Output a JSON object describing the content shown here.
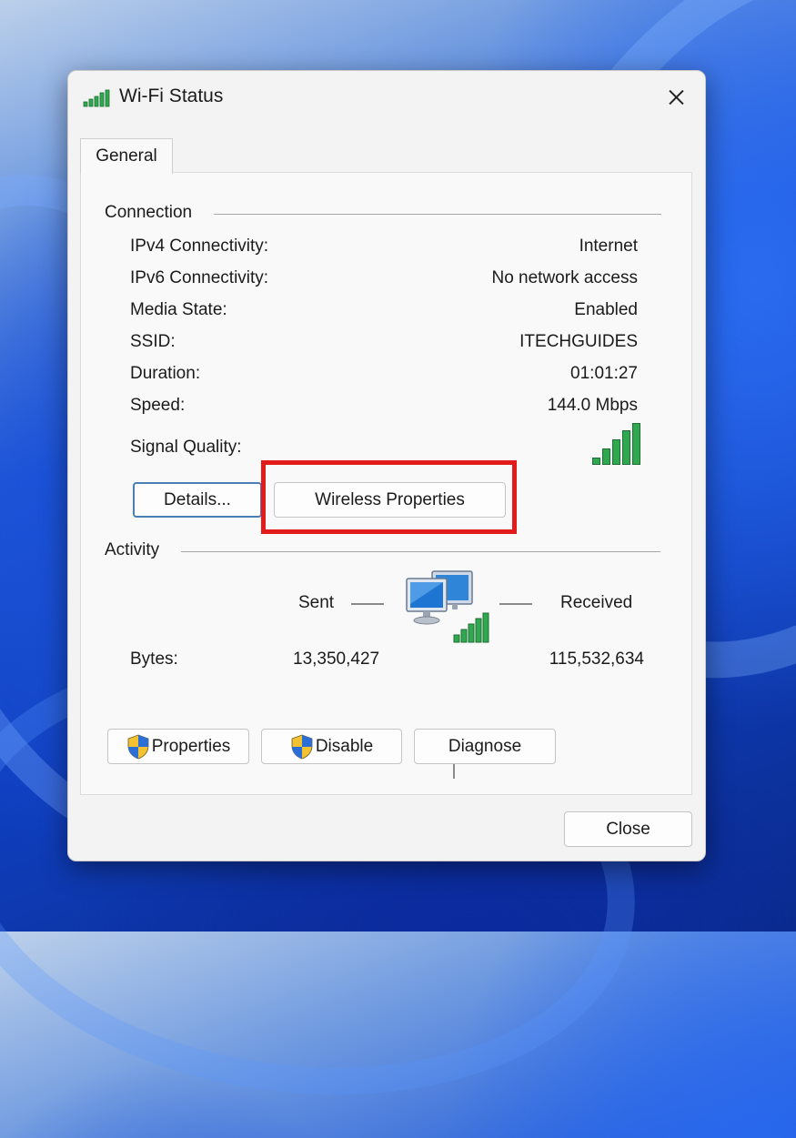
{
  "window": {
    "title": "Wi-Fi Status"
  },
  "tabs": [
    {
      "label": "General"
    }
  ],
  "connection": {
    "section_label": "Connection",
    "rows": [
      {
        "label": "IPv4 Connectivity:",
        "value": "Internet"
      },
      {
        "label": "IPv6 Connectivity:",
        "value": "No network access"
      },
      {
        "label": "Media State:",
        "value": "Enabled"
      },
      {
        "label": "SSID:",
        "value": "ITECHGUIDES"
      },
      {
        "label": "Duration:",
        "value": "01:01:27"
      },
      {
        "label": "Speed:",
        "value": "144.0 Mbps"
      }
    ],
    "signal_quality_label": "Signal Quality:",
    "signal_bars": 5,
    "details_button": "Details...",
    "wireless_properties_button": "Wireless Properties"
  },
  "activity": {
    "section_label": "Activity",
    "sent_label": "Sent",
    "received_label": "Received",
    "bytes_label": "Bytes:",
    "bytes_sent": "13,350,427",
    "bytes_received": "115,532,634"
  },
  "buttons": {
    "properties": "Properties",
    "disable": "Disable",
    "diagnose": "Diagnose",
    "close": "Close"
  },
  "icons": {
    "title": "wifi-signal-icon",
    "network": "network-computers-icon",
    "uac": "uac-shield-icon"
  },
  "colors": {
    "signal_green": "#2fa84f",
    "highlight_red": "#e21b1b",
    "default_button_border": "#4a7eb5"
  }
}
